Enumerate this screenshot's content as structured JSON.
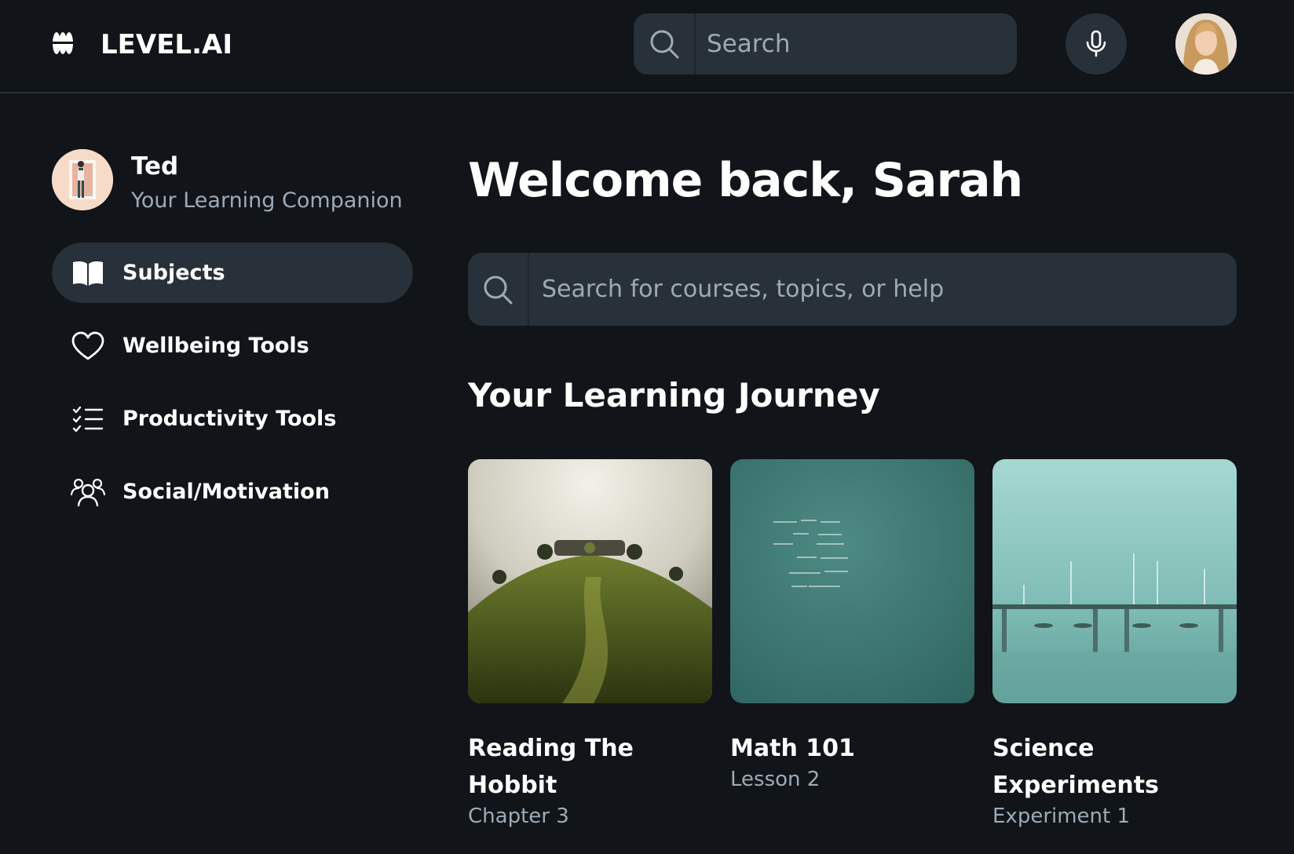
{
  "app": {
    "brand": "LEVEL.AI"
  },
  "header": {
    "search": {
      "placeholder": "Search"
    },
    "icons": {
      "logo": "logo-icon",
      "search": "search-icon",
      "mic": "microphone-icon",
      "avatar": "user-avatar"
    }
  },
  "companion": {
    "name": "Ted",
    "subtitle": "Your Learning Companion"
  },
  "sidebar": {
    "items": [
      {
        "label": "Subjects",
        "icon": "open-book-icon",
        "active": true
      },
      {
        "label": "Wellbeing Tools",
        "icon": "heart-icon",
        "active": false
      },
      {
        "label": "Productivity Tools",
        "icon": "checklist-icon",
        "active": false
      },
      {
        "label": "Social/Motivation",
        "icon": "users-icon",
        "active": false
      }
    ]
  },
  "main": {
    "welcome": "Welcome back, Sarah",
    "search": {
      "placeholder": "Search for courses, topics, or help"
    },
    "section_title": "Your Learning Journey",
    "cards": [
      {
        "title": "Reading The Hobbit",
        "subtitle": "Chapter 3",
        "image": "hobbit-hill-image"
      },
      {
        "title": "Math 101",
        "subtitle": "Lesson 2",
        "image": "chalkboard-math-image"
      },
      {
        "title": "Science Experiments",
        "subtitle": "Experiment 1",
        "image": "science-lab-image"
      }
    ]
  },
  "colors": {
    "background": "#111418",
    "surface": "#283039",
    "text_primary": "#ffffff",
    "text_secondary": "#9dabb8"
  }
}
